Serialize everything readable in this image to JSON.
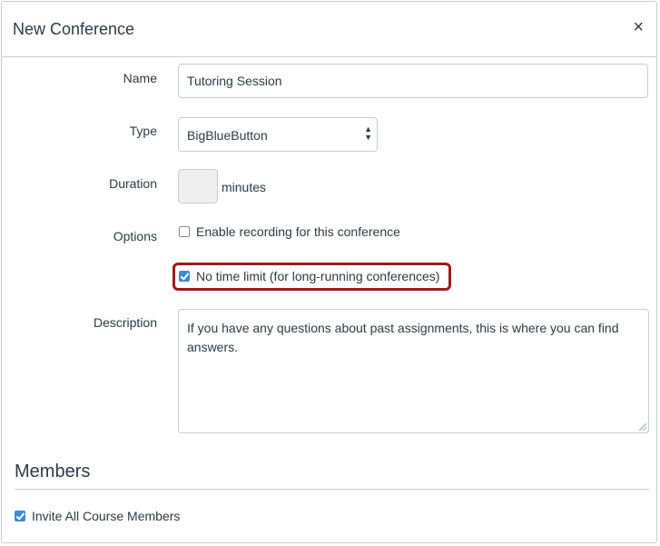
{
  "dialog": {
    "title": "New Conference",
    "close_glyph": "×"
  },
  "form": {
    "name": {
      "label": "Name",
      "value": "Tutoring Session"
    },
    "type": {
      "label": "Type",
      "selected": "BigBlueButton"
    },
    "duration": {
      "label": "Duration",
      "value": "",
      "unit": "minutes"
    },
    "options": {
      "label": "Options",
      "items": [
        {
          "label": "Enable recording for this conference",
          "checked": false
        },
        {
          "label": "No time limit (for long-running conferences)",
          "checked": true
        }
      ]
    },
    "description": {
      "label": "Description",
      "value": "If you have any questions about past assignments, this is where you can find answers."
    }
  },
  "members": {
    "title": "Members",
    "invite_all": {
      "label": "Invite All Course Members",
      "checked": true
    }
  },
  "colors": {
    "text": "#2d3b45",
    "border": "#c7cdd1",
    "checkbox_checked": "#3c8bd9",
    "highlight_outline": "#9e1b1b",
    "disabled_field": "#efefef"
  }
}
